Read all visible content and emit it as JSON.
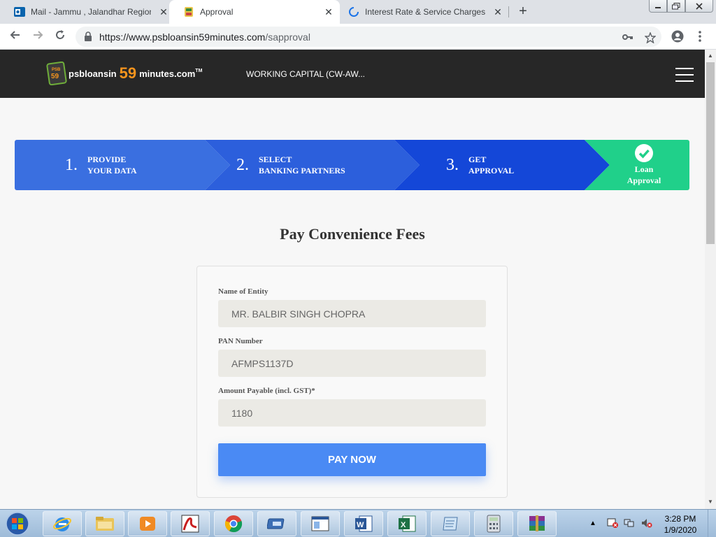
{
  "browser": {
    "tabs": [
      {
        "title": "Mail - Jammu , Jalandhar Region",
        "icon": "outlook-icon",
        "active": false
      },
      {
        "title": "Approval",
        "icon": "psb-favicon",
        "active": true
      },
      {
        "title": "Interest Rate & Service Charges |",
        "icon": "loading-spinner-icon",
        "active": false
      }
    ],
    "close_glyph": "✕",
    "new_tab_glyph": "+",
    "url_host": "https://www.psbloansin59minutes.com",
    "url_path": "/sapproval"
  },
  "header": {
    "brand_left": "psbloansin",
    "brand_number": "59",
    "brand_right": "minutes.com",
    "brand_tm": "TM",
    "product": "WORKING CAPITAL (CW-AW..."
  },
  "steps": [
    {
      "num": "1.",
      "line1": "PROVIDE",
      "line2": "YOUR DATA"
    },
    {
      "num": "2.",
      "line1": "SELECT",
      "line2": "BANKING PARTNERS"
    },
    {
      "num": "3.",
      "line1": "GET",
      "line2": "APPROVAL"
    },
    {
      "num": "",
      "line1": "Loan",
      "line2": "Approval"
    }
  ],
  "colors": {
    "step1": "#3a6fe0",
    "step2": "#2c5fdc",
    "step3": "#1447d8",
    "step4": "#20d08a",
    "pay_button": "#4a8af4"
  },
  "page": {
    "title": "Pay Convenience Fees"
  },
  "form": {
    "entity_label": "Name of Entity",
    "entity_value": "MR. BALBIR SINGH CHOPRA",
    "pan_label": "PAN Number",
    "pan_value": "AFMPS1137D",
    "amount_label": "Amount Payable (incl. GST)*",
    "amount_value": "1180",
    "pay_label": "PAY NOW"
  },
  "taskbar": {
    "time": "3:28 PM",
    "date": "1/9/2020",
    "apps": [
      "internet-explorer-icon",
      "file-explorer-icon",
      "media-player-icon",
      "acrobat-icon",
      "chrome-icon",
      "remote-desktop-icon",
      "window-app-icon",
      "word-icon",
      "excel-icon",
      "notepad-icon",
      "calculator-icon",
      "winrar-icon"
    ]
  }
}
